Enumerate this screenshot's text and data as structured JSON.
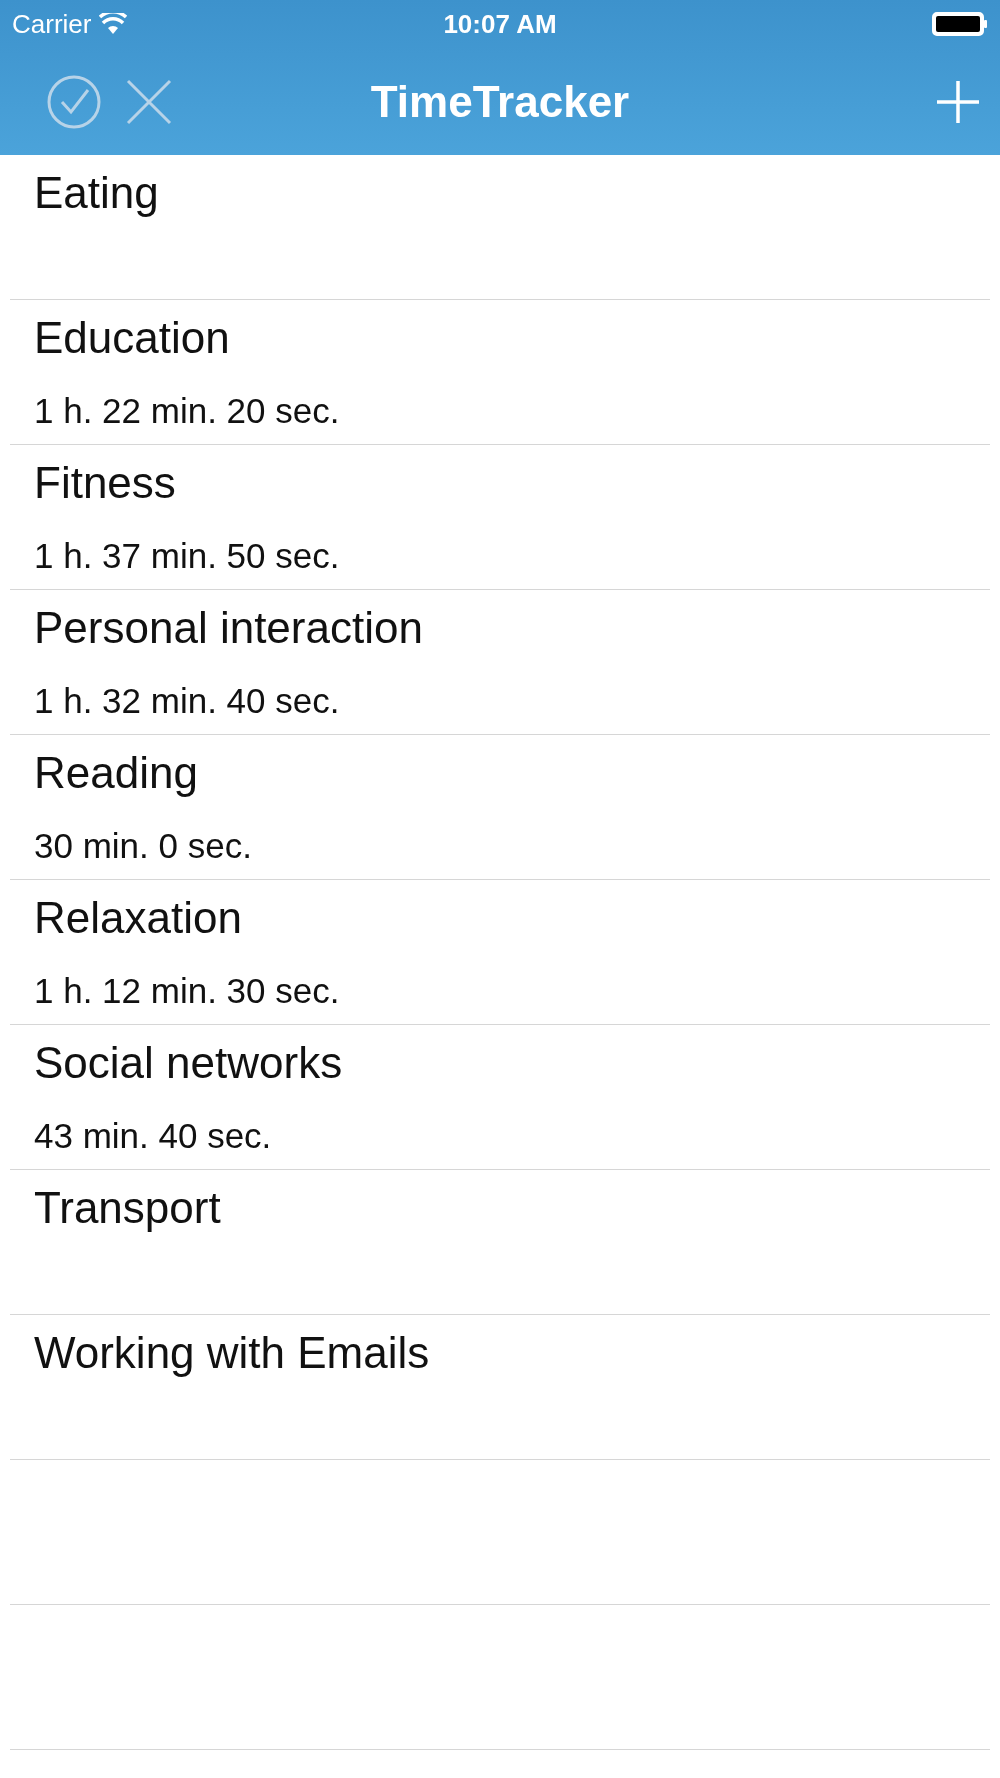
{
  "status_bar": {
    "carrier": "Carrier",
    "time": "10:07 AM"
  },
  "nav_bar": {
    "title": "TimeTracker"
  },
  "categories": [
    {
      "name": "Eating"
    },
    {
      "name": "Education",
      "duration": "1 h. 22 min. 20 sec."
    },
    {
      "name": "Fitness",
      "duration": "1 h. 37 min. 50 sec."
    },
    {
      "name": "Personal interaction",
      "duration": "1 h. 32 min. 40 sec."
    },
    {
      "name": "Reading",
      "duration": "30 min. 0 sec."
    },
    {
      "name": "Relaxation",
      "duration": "1 h. 12 min. 30 sec."
    },
    {
      "name": "Social networks",
      "duration": "43 min. 40 sec."
    },
    {
      "name": "Transport"
    },
    {
      "name": "Working with Emails"
    }
  ]
}
